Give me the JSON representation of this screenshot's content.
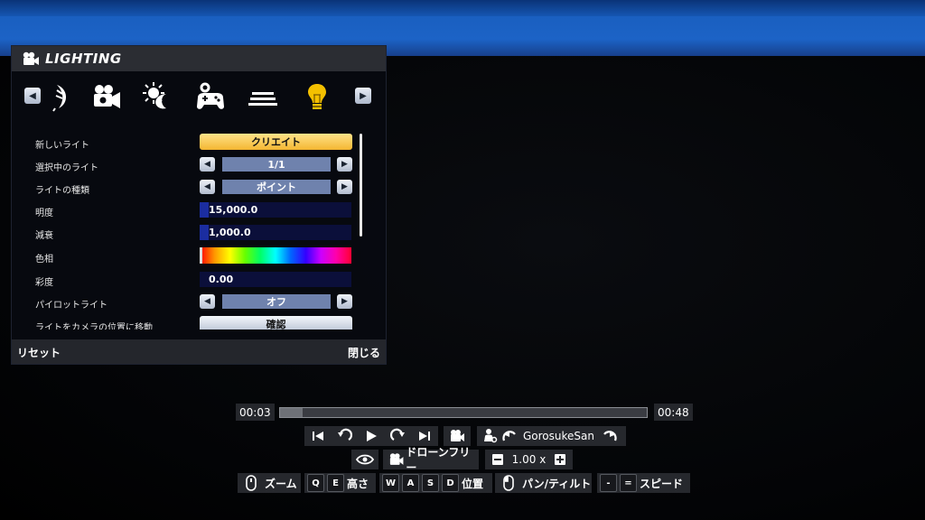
{
  "panel": {
    "title": "LIGHTING",
    "tabs": [
      {
        "icon": "leaf-icon"
      },
      {
        "icon": "camera-icon"
      },
      {
        "icon": "day-night-icon"
      },
      {
        "icon": "gamepad-icon"
      },
      {
        "icon": "layers-icon"
      },
      {
        "icon": "lightbulb-icon",
        "active": true
      }
    ],
    "rows": {
      "new_light": {
        "label": "新しいライト",
        "button": "クリエイト"
      },
      "selected_light": {
        "label": "選択中のライト",
        "value": "1/1"
      },
      "light_type": {
        "label": "ライトの種類",
        "value": "ポイント"
      },
      "brightness": {
        "label": "明度",
        "value": "15,000.0",
        "level": 0.06
      },
      "falloff": {
        "label": "減衰",
        "value": "1,000.0",
        "level": 0.06
      },
      "hue": {
        "label": "色相",
        "level": 0.0
      },
      "saturation": {
        "label": "彩度",
        "value": "0.00",
        "level": 0.0
      },
      "pilot_light": {
        "label": "パイロットライト",
        "value": "オフ"
      },
      "move_to_camera": {
        "label": "ライトをカメラの位置に移動",
        "button": "確認"
      }
    },
    "footer": {
      "reset": "リセット",
      "close": "閉じる"
    }
  },
  "timeline": {
    "current": "00:03",
    "total": "00:48",
    "progress": 0.0625
  },
  "controls": {
    "player_name": "GorosukeSan",
    "camera_mode": "ドローンフリー",
    "speed": "1.00 x",
    "zoom_label": "ズーム",
    "height_label": "高さ",
    "position_label": "位置",
    "pan_tilt_label": "パン/ティルト",
    "speed_label": "スピード",
    "keys": {
      "q": "Q",
      "e": "E",
      "w": "W",
      "a": "A",
      "s": "S",
      "d": "D",
      "minus": "-",
      "equal": "="
    }
  },
  "colors": {
    "accent_yellow": "#f4b632",
    "select_blue": "#6f82ad",
    "slider_bg": "#0b0f3a"
  }
}
